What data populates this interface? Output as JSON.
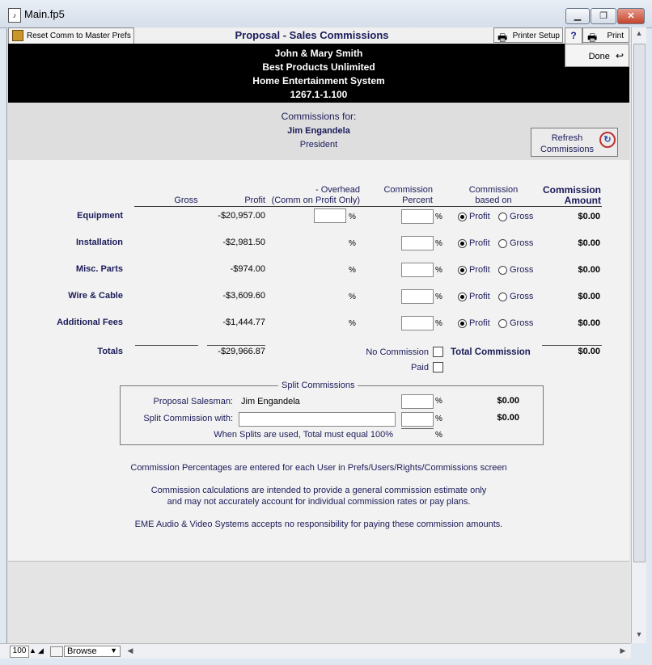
{
  "window": {
    "title": "Main.fp5",
    "minimize": "▁",
    "restore": "❐",
    "close": "✕"
  },
  "toolbar": {
    "reset_label": "Reset Comm to Master Prefs",
    "header_title": "Proposal - Sales Commissions",
    "printer_setup_label": "Printer Setup",
    "help_label": "?",
    "print_label": "Print",
    "done_label": "Done"
  },
  "client": {
    "name": "John & Mary Smith",
    "company": "Best Products Unlimited",
    "system": "Home Entertainment System",
    "number": "1267.1-1.100"
  },
  "commissions_for": {
    "heading": "Commissions for:",
    "person": "Jim Engandela",
    "role": "President",
    "refresh_label_1": "Refresh",
    "refresh_label_2": "Commissions"
  },
  "columns": {
    "gross": "Gross",
    "profit": "Profit",
    "overhead_1": "- Overhead",
    "overhead_2": "(Comm on Profit Only)",
    "comm_pct_1": "Commission",
    "comm_pct_2": "Percent",
    "based_1": "Commission",
    "based_2": "based on",
    "amount_1": "Commission",
    "amount_2": "Amount"
  },
  "rows": [
    {
      "label": "Equipment",
      "profit": "-$20,957.00",
      "amount": "$0.00",
      "basis": "Profit"
    },
    {
      "label": "Installation",
      "profit": "-$2,981.50",
      "amount": "$0.00",
      "basis": "Profit"
    },
    {
      "label": "Misc. Parts",
      "profit": "-$974.00",
      "amount": "$0.00",
      "basis": "Profit"
    },
    {
      "label": "Wire & Cable",
      "profit": "-$3,609.60",
      "amount": "$0.00",
      "basis": "Profit"
    },
    {
      "label": "Additional Fees",
      "profit": "-$1,444.77",
      "amount": "$0.00",
      "basis": "Profit"
    }
  ],
  "labels": {
    "percent_sign": "%",
    "profit_option": "Profit",
    "gross_option": "Gross"
  },
  "totals": {
    "label": "Totals",
    "profit": "-$29,966.87",
    "no_commission_label": "No Commission",
    "paid_label": "Paid",
    "total_commission_label": "Total Commission",
    "total_commission_value": "$0.00"
  },
  "split": {
    "title": "Split Commissions",
    "salesman_label": "Proposal Salesman:",
    "salesman_name": "Jim Engandela",
    "salesman_amount": "$0.00",
    "split_with_label": "Split Commission with:",
    "split_amount": "$0.00",
    "total_note": "When Splits are used, Total must equal 100%"
  },
  "notes": {
    "line1": "Commission Percentages are entered for each User in Prefs/Users/Rights/Commissions screen",
    "line2": "Commission calculations are intended to provide a general commission estimate only",
    "line3": "and may not accurately account for individual commission rates or pay plans.",
    "line4": "EME Audio & Video Systems accepts no responsibility for paying these commission amounts."
  },
  "statusbar": {
    "zoom": "100",
    "mode": "Browse"
  }
}
